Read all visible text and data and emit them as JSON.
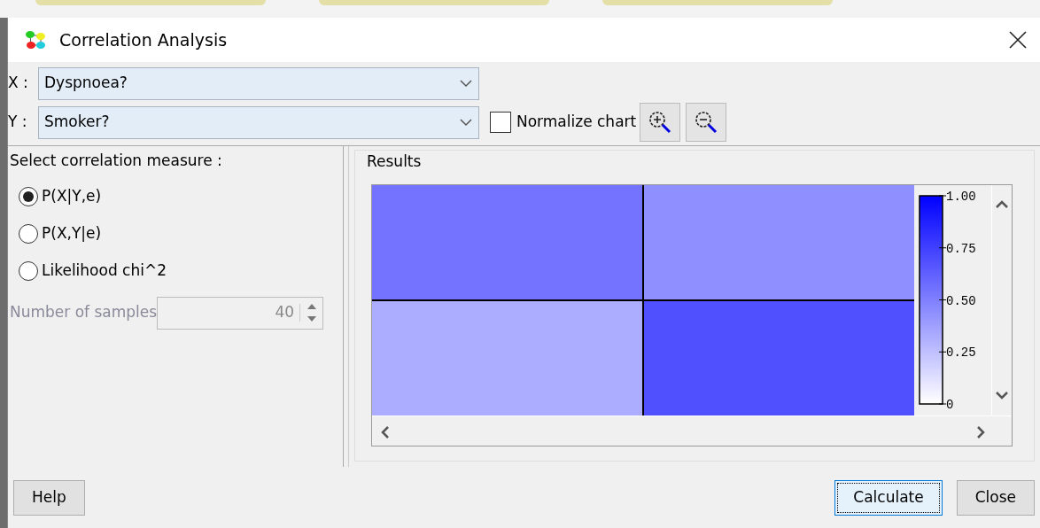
{
  "window": {
    "title": "Correlation Analysis"
  },
  "x_field": {
    "label": "X :",
    "value": "Dyspnoea?"
  },
  "y_field": {
    "label": "Y :",
    "value": "Smoker?"
  },
  "normalize_chart": {
    "label": "Normalize chart",
    "checked": false
  },
  "measure": {
    "title": "Select correlation measure :",
    "options": [
      {
        "label": "P(X|Y,e)",
        "selected": true
      },
      {
        "label": "P(X,Y|e)",
        "selected": false
      },
      {
        "label": "Likelihood chi^2",
        "selected": false
      }
    ]
  },
  "samples": {
    "label": "Number of samples",
    "value": "40",
    "disabled": true
  },
  "results": {
    "title": "Results",
    "cells": [
      [
        {
          "color": "#7373ff"
        },
        {
          "color": "#8f8fff"
        }
      ],
      [
        {
          "color": "#adadff"
        },
        {
          "color": "#5050ff"
        }
      ]
    ],
    "scale_ticks": [
      "1.00",
      "0.75",
      "0.50",
      "0.25",
      "0"
    ]
  },
  "buttons": [
    {
      "label": "Help",
      "focused": false
    },
    {
      "label": "Calculate",
      "focused": true
    },
    {
      "label": "Close",
      "focused": false
    }
  ]
}
